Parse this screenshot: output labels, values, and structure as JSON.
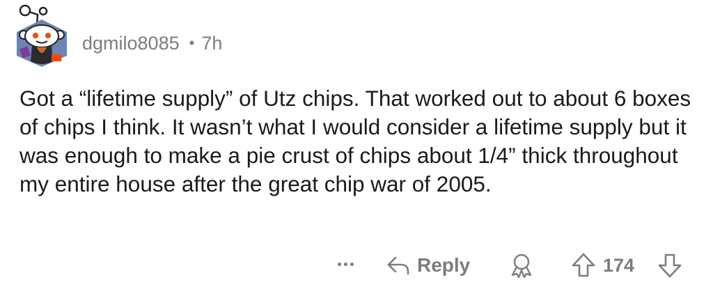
{
  "comment": {
    "author": "dgmilo8085",
    "separator": "•",
    "age": "7h",
    "body": "Got a “lifetime supply” of Utz chips. That worked out to about 6 boxes of chips I think. It wasn’t what I would consider a lifetime supply but it was enough to make a pie crust of chips about 1/4” thick throughout my entire house after the great chip war of 2005."
  },
  "actions": {
    "reply_label": "Reply",
    "score": "174"
  },
  "icons": {
    "avatar": "snoo-avatar",
    "more": "more-options-icon",
    "reply": "reply-arrow-icon",
    "award": "award-icon",
    "upvote": "upvote-arrow-icon",
    "downvote": "downvote-arrow-icon"
  },
  "colors": {
    "text": "#1a1a1b",
    "meta": "#7c7c7c",
    "avatar_bg": "#6a86b8",
    "accent_orange": "#ff4500"
  }
}
